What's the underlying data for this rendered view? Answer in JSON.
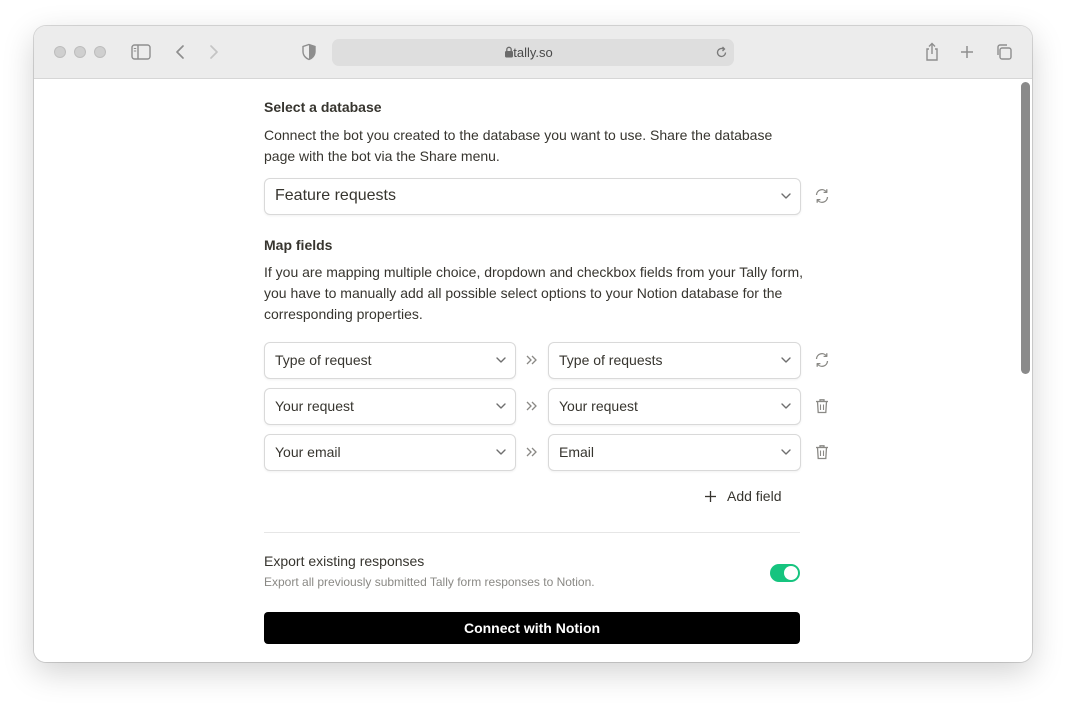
{
  "browser": {
    "url": "tally.so"
  },
  "database": {
    "heading": "Select a database",
    "description": "Connect the bot you created to the database you want to use. Share the database page with the bot via the Share menu.",
    "selected": "Feature requests"
  },
  "map_fields": {
    "heading": "Map fields",
    "description": "If you are mapping multiple choice, dropdown and checkbox fields from your Tally form, you have to manually add all possible select options to your Notion database for the corresponding properties.",
    "rows": [
      {
        "source": "Type of request",
        "target": "Type of requests"
      },
      {
        "source": "Your request",
        "target": "Your request"
      },
      {
        "source": "Your email",
        "target": "Email"
      }
    ],
    "add_field_label": "Add field"
  },
  "export": {
    "title": "Export existing responses",
    "subtitle": "Export all previously submitted Tally form responses to Notion.",
    "enabled": true
  },
  "connect_label": "Connect with Notion",
  "colors": {
    "toggle_on": "#16c47f",
    "button_bg": "#000000",
    "text": "#37352f"
  }
}
